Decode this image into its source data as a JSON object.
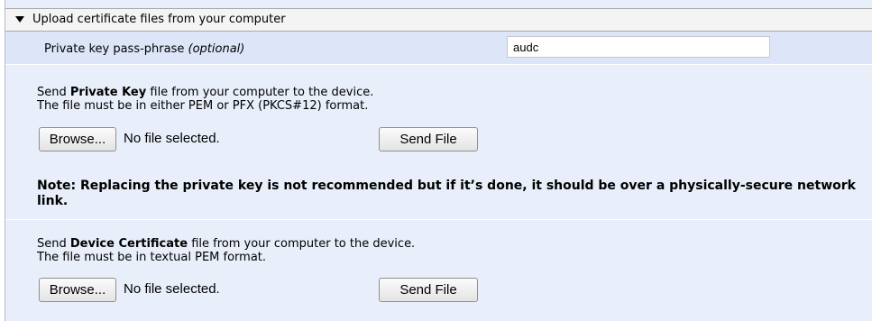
{
  "section": {
    "title": "Upload certificate files from your computer",
    "passphrase_label": "Private key pass-phrase",
    "passphrase_optional": "(optional)",
    "passphrase_value": "audc"
  },
  "private_key": {
    "line1_pre": "Send",
    "line1_bold": "Private Key",
    "line1_post": "file from your computer to the device.",
    "line2": "The file must be in either PEM or PFX (PKCS#12) format.",
    "browse_label": "Browse...",
    "file_status": "No file selected.",
    "send_label": "Send File"
  },
  "note": "Note: Replacing the private key is not recommended but if it’s done, it should be over a physically-secure network link.",
  "device_cert": {
    "line1_pre": "Send",
    "line1_bold": "Device Certificate",
    "line1_post": "file from your computer to the device.",
    "line2": "The file must be in textual PEM format.",
    "browse_label": "Browse...",
    "file_status": "No file selected.",
    "send_label": "Send File"
  }
}
